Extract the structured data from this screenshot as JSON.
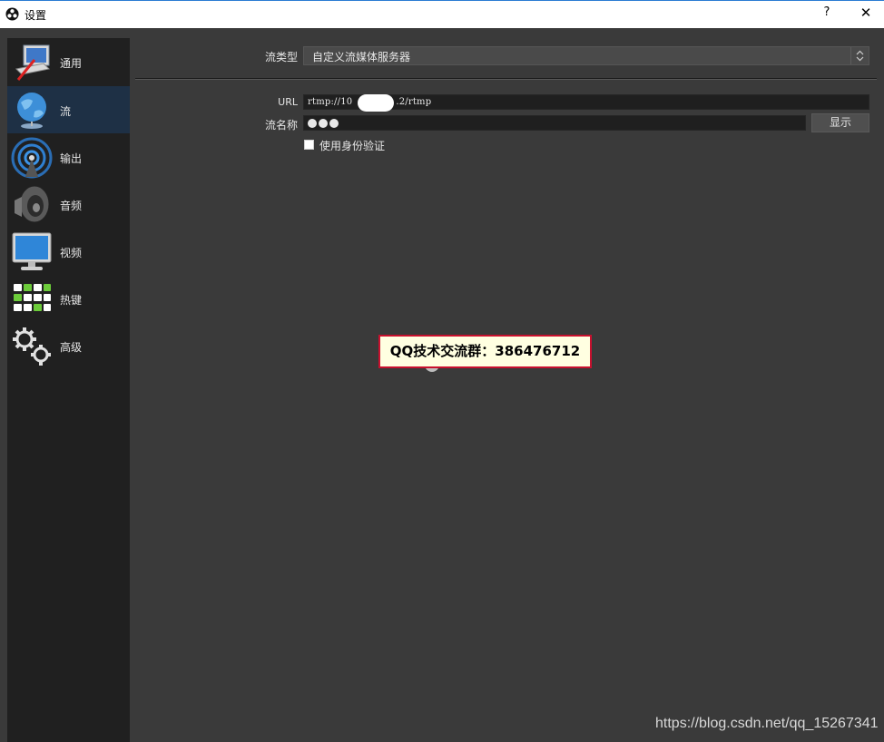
{
  "window": {
    "title": "设置",
    "help_label": "?",
    "close_label": "✕"
  },
  "sidebar": {
    "items": [
      {
        "label": "通用",
        "icon": "general-settings-icon",
        "active": false
      },
      {
        "label": "流",
        "icon": "stream-globe-icon",
        "active": true
      },
      {
        "label": "输出",
        "icon": "output-broadcast-icon",
        "active": false
      },
      {
        "label": "音频",
        "icon": "audio-speaker-icon",
        "active": false
      },
      {
        "label": "视频",
        "icon": "video-monitor-icon",
        "active": false
      },
      {
        "label": "热键",
        "icon": "hotkeys-keyboard-icon",
        "active": false
      },
      {
        "label": "高级",
        "icon": "advanced-gears-icon",
        "active": false
      }
    ]
  },
  "stream": {
    "type_label": "流类型",
    "type_value": "自定义流媒体服务器",
    "url_label": "URL",
    "url_value_start": "rtmp://10",
    "url_value_end": ".2/rtmp",
    "key_label": "流名称",
    "show_button": "显示",
    "auth_checkbox_label": "使用身份验证",
    "auth_checked": false
  },
  "overlay": {
    "watermark_text": "QQ技术交流群：386476712",
    "csdn_url": "https://blog.csdn.net/qq_15267341"
  },
  "colors": {
    "background": "#3a3a3a",
    "sidebar": "#202020",
    "sidebar_active": "#1e3045",
    "watermark_border": "#c8102e",
    "watermark_bg": "#ffffe1"
  }
}
